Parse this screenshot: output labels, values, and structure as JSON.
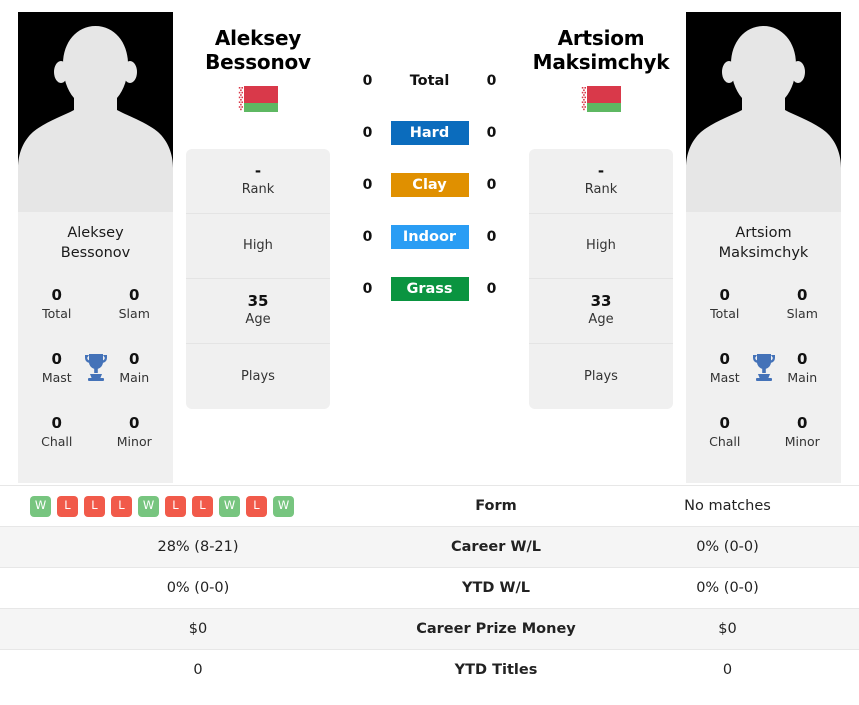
{
  "players": {
    "left": {
      "first_name": "Aleksey",
      "last_name": "Bessonov",
      "full_name": "Aleksey Bessonov",
      "photo_label_line1": "Aleksey",
      "photo_label_line2": "Bessonov",
      "flag": "belarus-flag",
      "flag_name": "Belarus",
      "info": [
        {
          "value": "-",
          "label": "Rank"
        },
        {
          "value": "",
          "label": "High"
        },
        {
          "value": "35",
          "label": "Age"
        },
        {
          "value": "",
          "label": "Plays"
        }
      ],
      "titles": [
        {
          "value": "0",
          "label": "Total"
        },
        {
          "value": "0",
          "label": "Slam"
        },
        {
          "value": "0",
          "label": "Mast"
        },
        {
          "value": "0",
          "label": "Main"
        },
        {
          "value": "0",
          "label": "Chall"
        },
        {
          "value": "0",
          "label": "Minor"
        }
      ],
      "surface_counts": [
        "0",
        "0",
        "0",
        "0",
        "0"
      ],
      "form": [
        "W",
        "L",
        "L",
        "L",
        "W",
        "L",
        "L",
        "W",
        "L",
        "W"
      ],
      "career_wl": "28% (8-21)",
      "ytd_wl": "0% (0-0)",
      "career_prize_money": "$0",
      "ytd_titles": "0"
    },
    "right": {
      "first_name": "Artsiom",
      "last_name": "Maksimchyk",
      "full_name": "Artsiom Maksimchyk",
      "photo_label_line1": "Artsiom",
      "photo_label_line2": "Maksimchyk",
      "flag": "belarus-flag",
      "flag_name": "Belarus",
      "info": [
        {
          "value": "-",
          "label": "Rank"
        },
        {
          "value": "",
          "label": "High"
        },
        {
          "value": "33",
          "label": "Age"
        },
        {
          "value": "",
          "label": "Plays"
        }
      ],
      "titles": [
        {
          "value": "0",
          "label": "Total"
        },
        {
          "value": "0",
          "label": "Slam"
        },
        {
          "value": "0",
          "label": "Mast"
        },
        {
          "value": "0",
          "label": "Main"
        },
        {
          "value": "0",
          "label": "Chall"
        },
        {
          "value": "0",
          "label": "Minor"
        }
      ],
      "surface_counts": [
        "0",
        "0",
        "0",
        "0",
        "0"
      ],
      "form_text": "No matches",
      "career_wl": "0% (0-0)",
      "ytd_wl": "0% (0-0)",
      "career_prize_money": "$0",
      "ytd_titles": "0"
    }
  },
  "surfaces": [
    {
      "label": "Total",
      "color": "",
      "text_color": "#111111"
    },
    {
      "label": "Hard",
      "color": "#0b6cbd",
      "text_color": "#ffffff"
    },
    {
      "label": "Clay",
      "color": "#e09000",
      "text_color": "#ffffff"
    },
    {
      "label": "Indoor",
      "color": "#2a9df4",
      "text_color": "#ffffff"
    },
    {
      "label": "Grass",
      "color": "#0a9440",
      "text_color": "#ffffff"
    }
  ],
  "table": {
    "rows": [
      {
        "label": "Form"
      },
      {
        "label": "Career W/L"
      },
      {
        "label": "YTD W/L"
      },
      {
        "label": "Career Prize Money"
      },
      {
        "label": "YTD Titles"
      }
    ]
  },
  "colors": {
    "win_pill": "#77c57f",
    "loss_pill": "#f15a4a",
    "trophy": "#4472b8",
    "panel_bg": "#f0f0f0",
    "row_alt_bg": "#f5f5f5",
    "flag_red": "#d9394a",
    "flag_green": "#5eb862"
  }
}
